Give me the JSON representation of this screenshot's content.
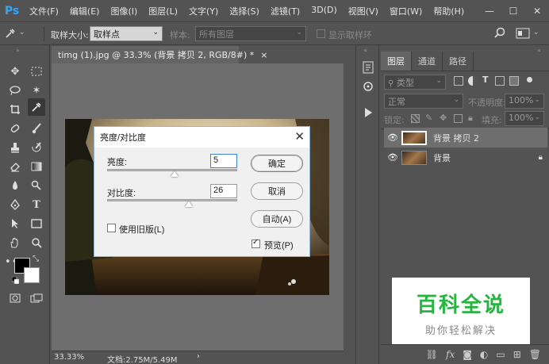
{
  "app": {
    "logo": "Ps"
  },
  "menu": [
    "文件(F)",
    "编辑(E)",
    "图像(I)",
    "图层(L)",
    "文字(Y)",
    "选择(S)",
    "滤镜(T)",
    "3D(D)",
    "视图(V)",
    "窗口(W)",
    "帮助(H)"
  ],
  "window_controls": {
    "minimize": "—",
    "maximize": "☐",
    "close": "✕"
  },
  "options": {
    "sample_size_label": "取样大小:",
    "sample_size_value": "取样点",
    "sample_label": "样本:",
    "sample_value": "所有图层",
    "show_ring_label": "显示取样环"
  },
  "document": {
    "tab_title": "timg (1).jpg @ 33.3% (背景 拷贝 2, RGB/8#) *",
    "tab_close": "×",
    "zoom": "33.33%",
    "doc_info": "文档:2.75M/5.49M",
    "status_arrow": "›"
  },
  "layers_panel": {
    "tabs": [
      "图层",
      "通道",
      "路径"
    ],
    "kind_filter": "类型",
    "blend_mode": "正常",
    "opacity_label": "不透明度:",
    "opacity_value": "100%",
    "lock_label": "锁定:",
    "fill_label": "填充:",
    "fill_value": "100%",
    "layers": [
      {
        "name": "背景 拷贝 2",
        "selected": true,
        "locked": false
      },
      {
        "name": "背景",
        "selected": false,
        "locked": true
      }
    ]
  },
  "dialog": {
    "title": "亮度/对比度",
    "close": "✕",
    "brightness_label": "亮度:",
    "brightness_value": "5",
    "brightness_slider": 0.52,
    "contrast_label": "对比度:",
    "contrast_value": "26",
    "contrast_slider": 0.63,
    "legacy_label": "使用旧版(L)",
    "legacy_checked": false,
    "ok_label": "确定",
    "cancel_label": "取消",
    "auto_label": "自动(A)",
    "preview_label": "预览(P)",
    "preview_checked": true
  },
  "watermark": {
    "title": "百科全说",
    "subtitle": "助你轻松解决"
  },
  "colors": {
    "ui_bg": "#535353",
    "canvas_bg": "#6e6e6e",
    "accent_ps": "#31a8ff",
    "watermark_green": "#26b53f",
    "foreground_swatch": "#000000",
    "background_swatch": "#ffffff"
  }
}
